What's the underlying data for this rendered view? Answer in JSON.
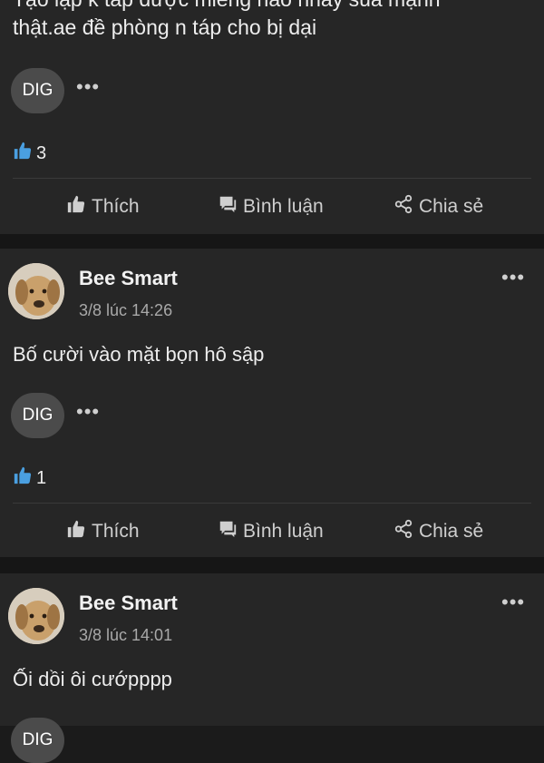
{
  "colors": {
    "background": "#1b1b1b",
    "card": "#262626",
    "like_blue": "#4a9fe0",
    "muted": "#a9a9a9"
  },
  "actions": {
    "like": "Thích",
    "comment": "Bình luận",
    "share": "Chia sẻ"
  },
  "posts": [
    {
      "text_line1": "Tạo lập k táp được miếng nào nhảy sủa mạnh",
      "text_line2": "thật.ae đề phòng n táp cho bị dại",
      "reaction_label": "DIG",
      "like_count": "3"
    },
    {
      "author": "Bee Smart",
      "time": "3/8 lúc 14:26",
      "text": "Bố cười vào mặt bọn hô sập",
      "reaction_label": "DIG",
      "like_count": "1"
    },
    {
      "author": "Bee Smart",
      "time": "3/8 lúc 14:01",
      "text": "Ối dồi ôi cướpppp",
      "reaction_label": "DIG"
    }
  ]
}
